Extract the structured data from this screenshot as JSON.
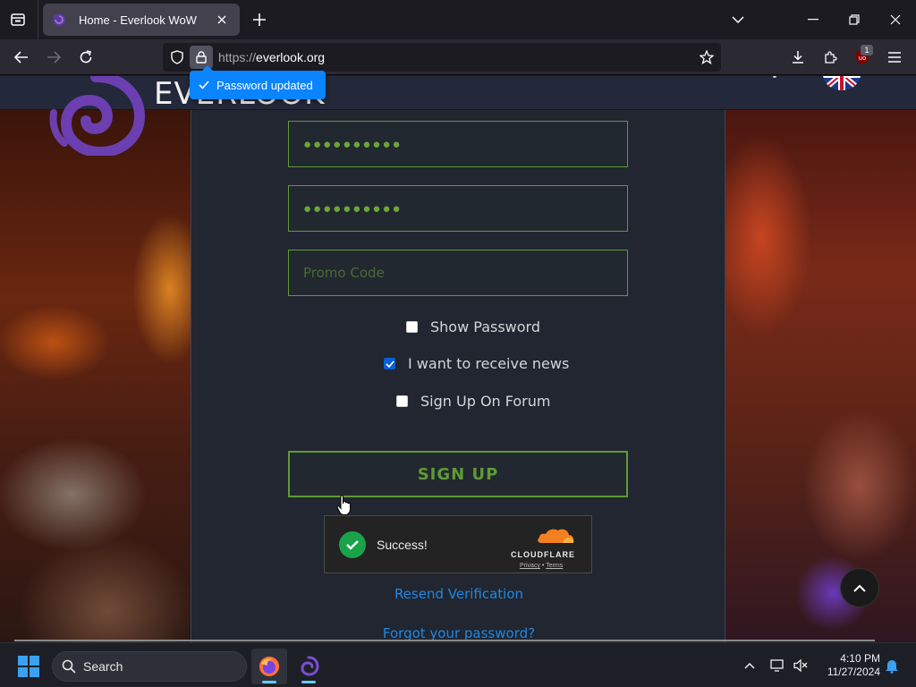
{
  "browser": {
    "tab": {
      "title": "Home - Everlook WoW"
    },
    "url": {
      "scheme": "https://",
      "host": "everlook.org"
    },
    "extension_badge": "1",
    "password_toast": "Password updated"
  },
  "site": {
    "logo_text": "EVERLOOK"
  },
  "form": {
    "password_mask": "●●●●●●●●●●",
    "confirm_mask": "●●●●●●●●●●",
    "promo_placeholder": "Promo Code",
    "show_password_label": "Show Password",
    "show_password_checked": false,
    "news_label": "I want to receive news",
    "news_checked": true,
    "forum_label": "Sign Up On Forum",
    "forum_checked": false,
    "signup_label": "SIGN UP",
    "captcha": {
      "status": "Success!",
      "brand": "CLOUDFLARE",
      "privacy": "Privacy",
      "separator": "•",
      "terms": "Terms"
    },
    "resend_link": "Resend Verification",
    "forgot_link": "Forgot your password?"
  },
  "taskbar": {
    "search_label": "Search",
    "time": "4:10 PM",
    "date": "11/27/2024"
  },
  "colors": {
    "accent_green": "#5f9a35",
    "link_blue": "#1e88e5",
    "toast_blue": "#0a84ff"
  }
}
